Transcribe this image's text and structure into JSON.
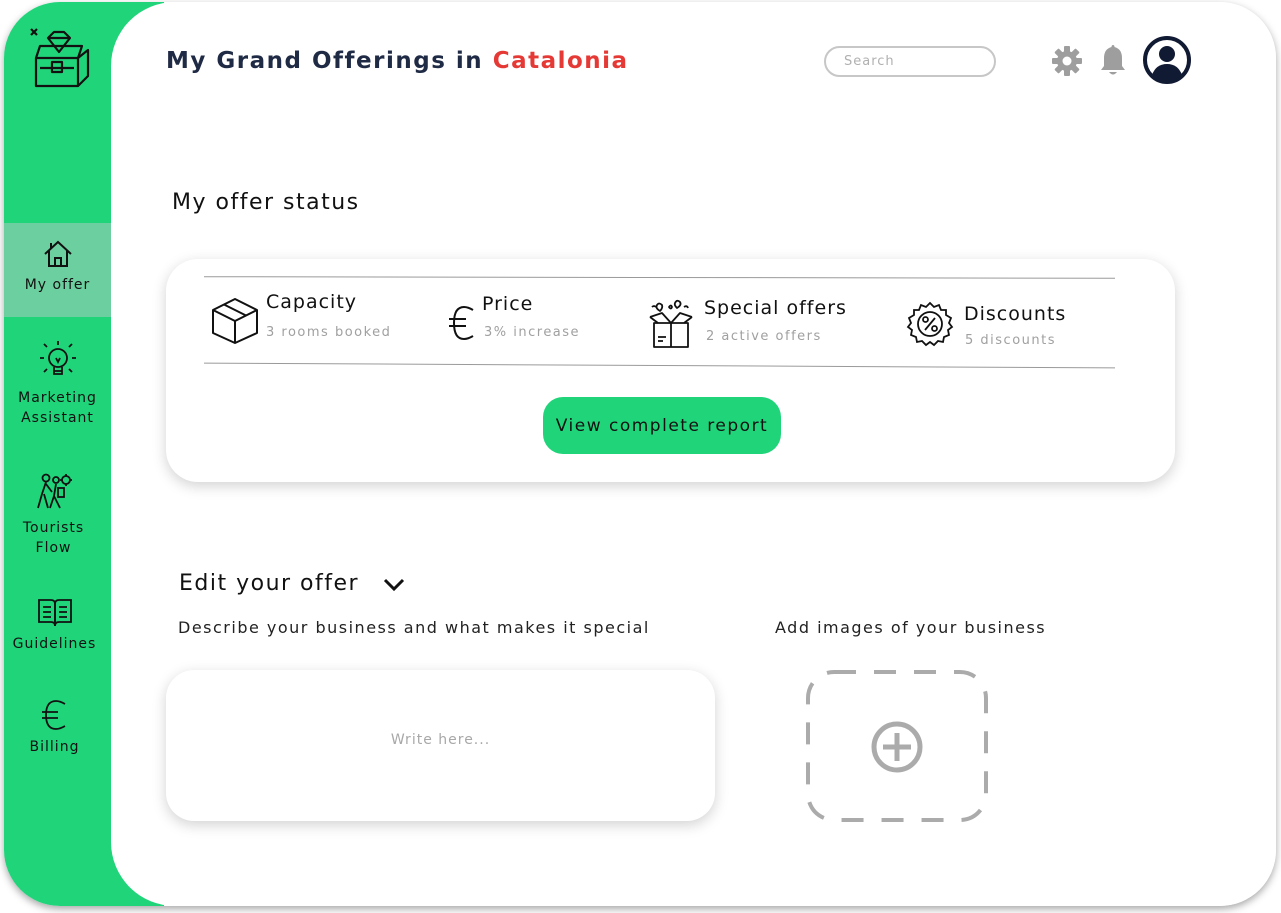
{
  "header": {
    "title_prefix": "My Grand Offerings in",
    "title_region": "Catalonia",
    "search_placeholder": "Search"
  },
  "sidebar": {
    "logo": "treasure-chest-icon",
    "items": [
      {
        "label_lines": [
          "My offer"
        ],
        "icon": "home-icon",
        "active": true
      },
      {
        "label_lines": [
          "Marketing",
          "Assistant"
        ],
        "icon": "lightbulb-icon",
        "active": false
      },
      {
        "label_lines": [
          "Tourists",
          "Flow"
        ],
        "icon": "tourists-icon",
        "active": false
      },
      {
        "label_lines": [
          "Guidelines"
        ],
        "icon": "book-icon",
        "active": false
      },
      {
        "label_lines": [
          "Billing"
        ],
        "icon": "euro-icon",
        "active": false
      }
    ]
  },
  "status": {
    "title": "My offer status",
    "items": [
      {
        "label": "Capacity",
        "sub": "3 rooms booked",
        "icon": "box-icon"
      },
      {
        "label": "Price",
        "sub": "3% increase",
        "icon": "euro-icon"
      },
      {
        "label": "Special offers",
        "sub": "2 active offers",
        "icon": "gift-box-icon"
      },
      {
        "label": "Discounts",
        "sub": "5 discounts",
        "icon": "percent-badge-icon"
      }
    ],
    "report_button": "View complete report"
  },
  "edit": {
    "title": "Edit your offer",
    "describe_label": "Describe your business and what makes it special",
    "describe_placeholder": "Write here...",
    "images_label": "Add images of your business"
  },
  "colors": {
    "brand_green": "#20d47a",
    "active_nav": "#6ccf9f",
    "accent_red": "#e53935",
    "title_navy": "#1f2a44"
  }
}
